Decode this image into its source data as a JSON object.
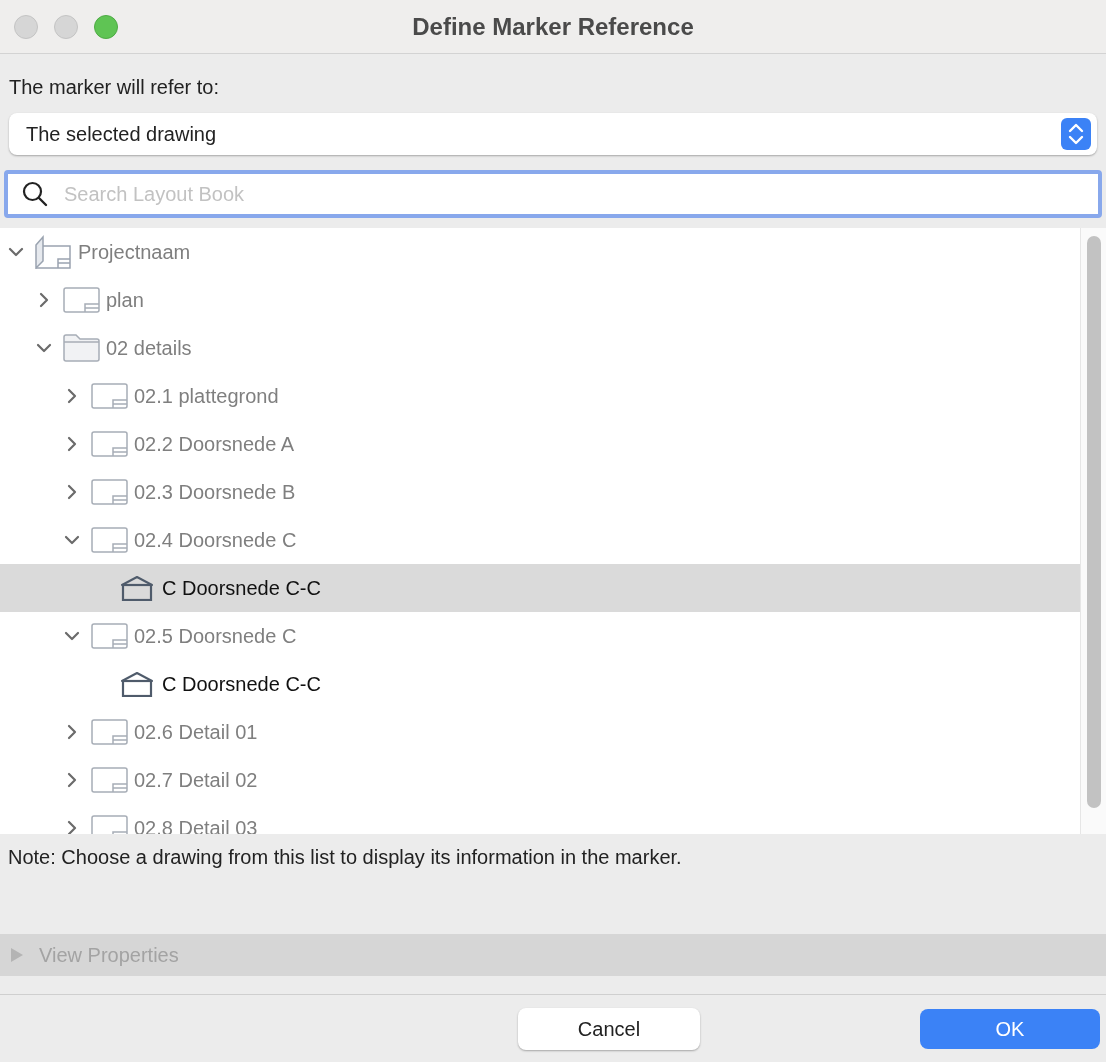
{
  "window": {
    "title": "Define Marker Reference"
  },
  "refer_label": "The marker will refer to:",
  "refer_select": {
    "value": "The selected drawing"
  },
  "search": {
    "placeholder": "Search Layout Book"
  },
  "tree": [
    {
      "label": "Projectnaam",
      "kind": "project",
      "expanded": true,
      "selected": false,
      "children": [
        {
          "label": "plan",
          "kind": "layout",
          "expanded": false,
          "selected": false
        },
        {
          "label": "02 details",
          "kind": "folder",
          "expanded": true,
          "selected": false,
          "children": [
            {
              "label": "02.1 plattegrond",
              "kind": "layout",
              "expanded": false,
              "selected": false
            },
            {
              "label": "02.2 Doorsnede A",
              "kind": "layout",
              "expanded": false,
              "selected": false
            },
            {
              "label": "02.3 Doorsnede B",
              "kind": "layout",
              "expanded": false,
              "selected": false
            },
            {
              "label": "02.4 Doorsnede C",
              "kind": "layout",
              "expanded": true,
              "selected": false,
              "children": [
                {
                  "label": "C Doorsnede C-C",
                  "kind": "drawing",
                  "selected": true
                }
              ]
            },
            {
              "label": "02.5 Doorsnede C",
              "kind": "layout",
              "expanded": true,
              "selected": false,
              "children": [
                {
                  "label": "C Doorsnede C-C",
                  "kind": "drawing",
                  "selected": false
                }
              ]
            },
            {
              "label": "02.6 Detail 01",
              "kind": "layout",
              "expanded": false,
              "selected": false
            },
            {
              "label": "02.7 Detail 02",
              "kind": "layout",
              "expanded": false,
              "selected": false
            },
            {
              "label": "02.8 Detail 03",
              "kind": "layout",
              "expanded": false,
              "selected": false
            }
          ]
        }
      ]
    }
  ],
  "note": "Note: Choose a drawing from this list to display its information in the marker.",
  "view_properties": {
    "label": "View Properties",
    "expanded": false,
    "disabled": true
  },
  "buttons": [
    {
      "label": "Cancel",
      "kind": "secondary"
    },
    {
      "label": "OK",
      "kind": "primary"
    }
  ]
}
